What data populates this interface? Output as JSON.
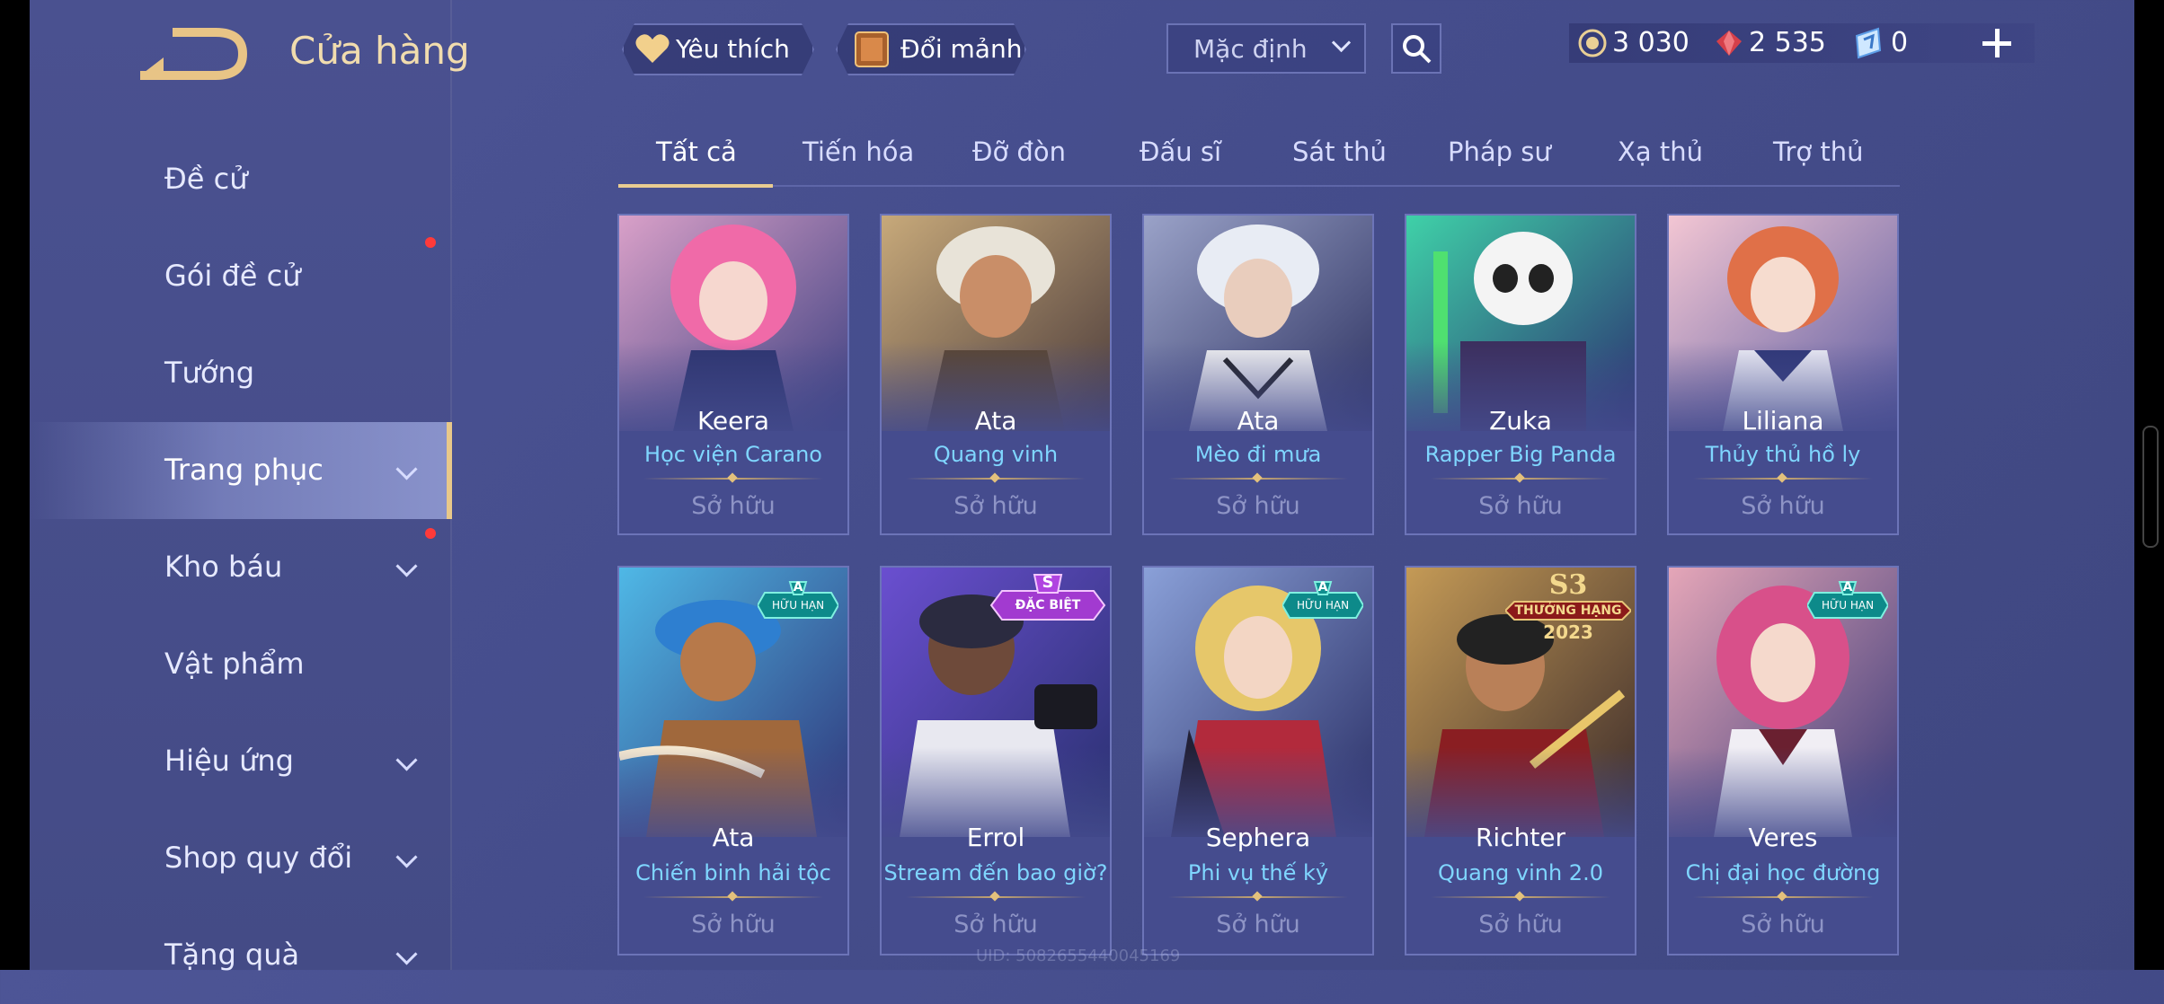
{
  "header": {
    "title": "Cửa hàng",
    "favorite_label": "Yêu thích",
    "exchange_label": "Đổi mảnh",
    "sort_value": "Mặc định",
    "currencies": {
      "gold": "3 030",
      "ruby": "2 535",
      "voucher": "0"
    }
  },
  "sidebar": {
    "items": [
      {
        "label": "Đề cử"
      },
      {
        "label": "Gói đề cử"
      },
      {
        "label": "Tướng"
      },
      {
        "label": "Trang phục"
      },
      {
        "label": "Kho báu"
      },
      {
        "label": "Vật phẩm"
      },
      {
        "label": "Hiệu ứng"
      },
      {
        "label": "Shop quy đổi"
      },
      {
        "label": "Tặng quà"
      }
    ]
  },
  "tabs": [
    "Tất cả",
    "Tiến hóa",
    "Đỡ đòn",
    "Đấu sĩ",
    "Sát thủ",
    "Pháp sư",
    "Xạ thủ",
    "Trợ thủ"
  ],
  "cards": [
    {
      "hero": "Keera",
      "skin": "Học viện Carano",
      "status": "Sở hữu"
    },
    {
      "hero": "Ata",
      "skin": "Quang vinh",
      "status": "Sở hữu"
    },
    {
      "hero": "Ata",
      "skin": "Mèo đi mưa",
      "status": "Sở hữu"
    },
    {
      "hero": "Zuka",
      "skin": "Rapper Big Panda",
      "status": "Sở hữu"
    },
    {
      "hero": "Liliana",
      "skin": "Thủy thủ hồ ly",
      "status": "Sở hữu"
    },
    {
      "hero": "Ata",
      "skin": "Chiến binh hải tộc",
      "status": "Sở hữu",
      "badge_grade": "A",
      "badge_text": "HỮU HẠN"
    },
    {
      "hero": "Errol",
      "skin": "Stream đến bao giờ?",
      "status": "Sở hữu",
      "badge_grade": "S",
      "badge_text": "ĐẶC BIỆT"
    },
    {
      "hero": "Sephera",
      "skin": "Phi vụ thế kỷ",
      "status": "Sở hữu",
      "badge_grade": "A",
      "badge_text": "HỮU HẠN"
    },
    {
      "hero": "Richter",
      "skin": "Quang vinh 2.0",
      "status": "Sở hữu",
      "badge_grade": "S3",
      "badge_text": "THƯỞNG HẠNG",
      "badge_year": "2023"
    },
    {
      "hero": "Veres",
      "skin": "Chị đại học đường",
      "status": "Sở hữu",
      "badge_grade": "A",
      "badge_text": "HỮU HẠN"
    }
  ],
  "uid_text": "UID: 5082655440045169",
  "colors": {
    "accent_gold": "#e9cc91",
    "skin_name": "#7fd6ff",
    "notification": "#ff3a3a"
  }
}
